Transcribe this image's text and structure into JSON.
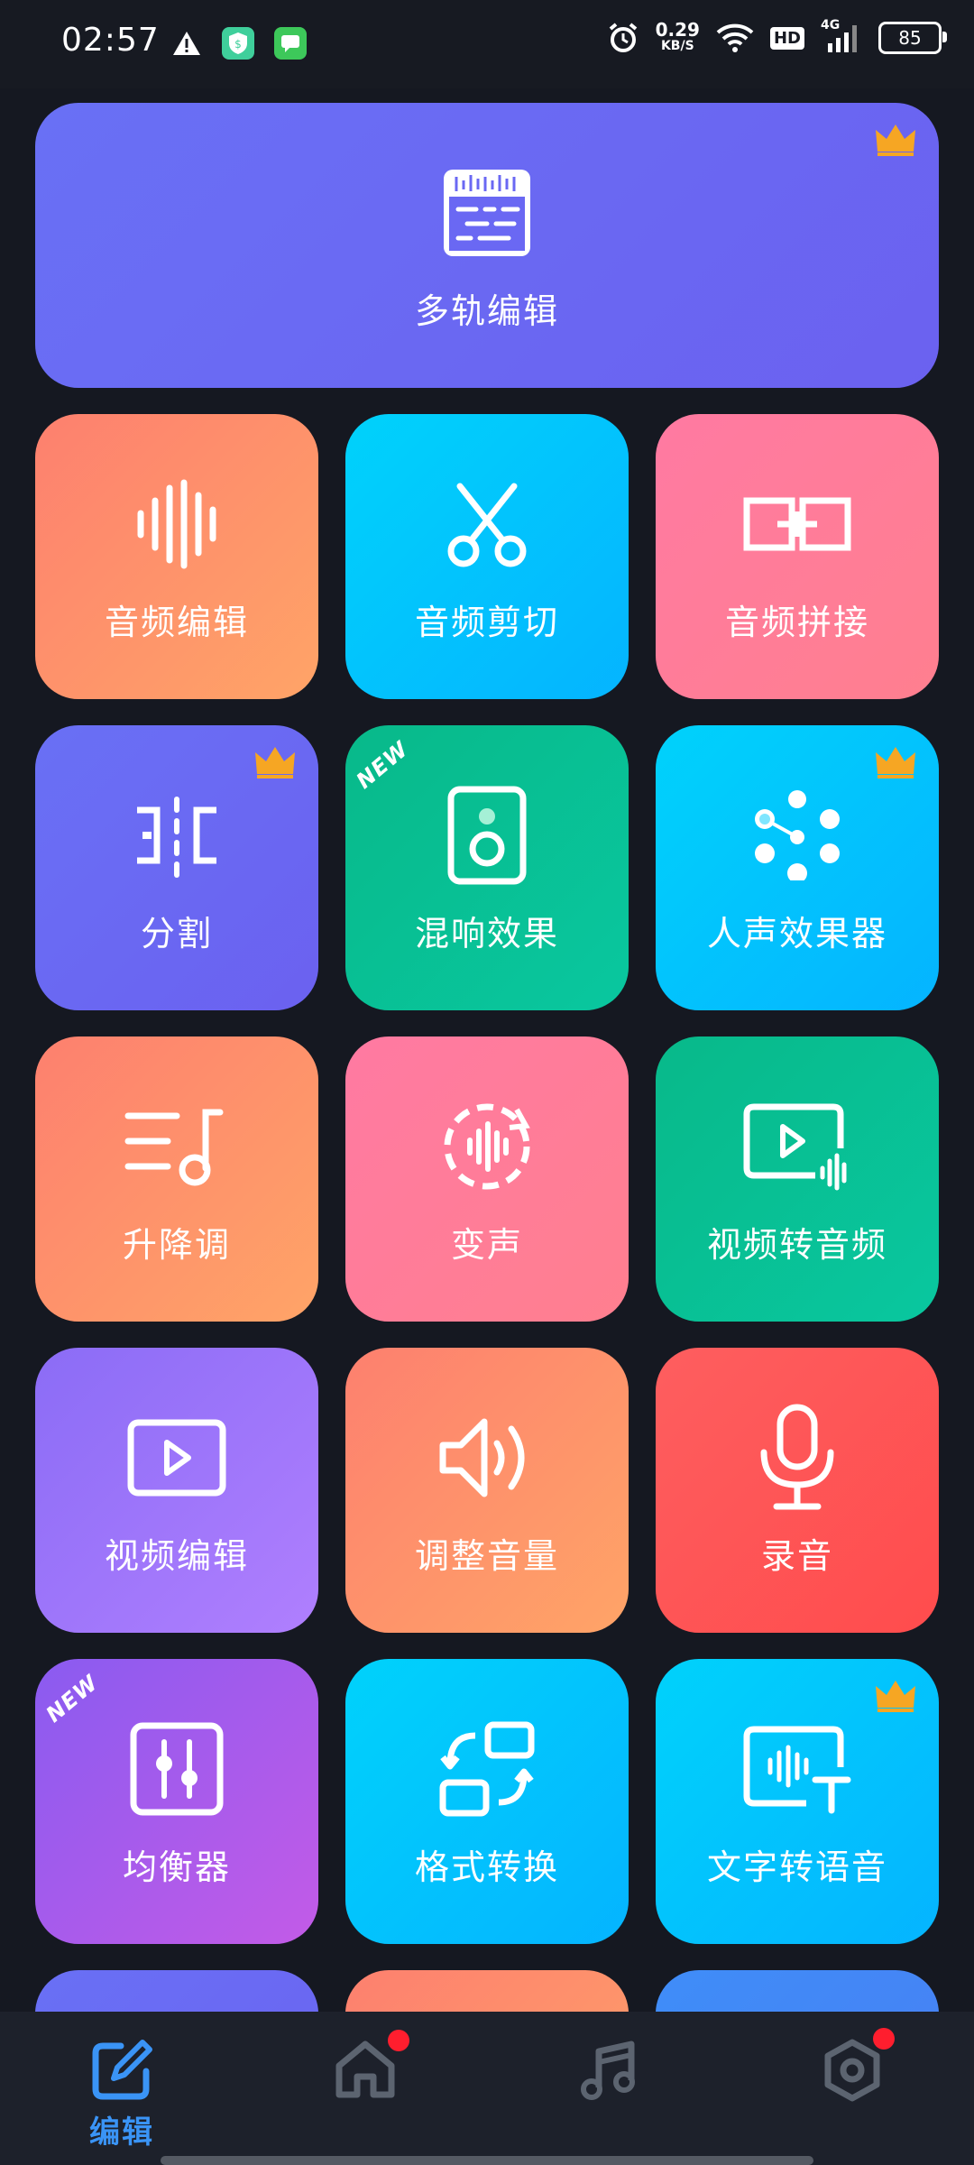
{
  "status_bar": {
    "time": "02:57",
    "speed_value": "0.29",
    "speed_unit": "KB/S",
    "network": "4G",
    "hd": "HD",
    "battery": "85",
    "icons": [
      "warning-icon",
      "shield-app-icon",
      "message-app-icon",
      "alarm-icon",
      "wifi-icon",
      "signal-icon",
      "battery-icon"
    ]
  },
  "colors": {
    "background": "#151821",
    "nav_active": "#3a94f6",
    "badge": "#ff1e2e",
    "crown": "#f6a623"
  },
  "tools": [
    {
      "id": "multitrack",
      "label": "多轨编辑",
      "icon": "multitrack-icon",
      "premium": true,
      "new": false
    },
    {
      "id": "audio-edit",
      "label": "音频编辑",
      "icon": "waveform-icon",
      "premium": false,
      "new": false
    },
    {
      "id": "audio-cut",
      "label": "音频剪切",
      "icon": "scissors-icon",
      "premium": false,
      "new": false
    },
    {
      "id": "audio-join",
      "label": "音频拼接",
      "icon": "join-icon",
      "premium": false,
      "new": false
    },
    {
      "id": "split",
      "label": "分割",
      "icon": "split-icon",
      "premium": true,
      "new": false
    },
    {
      "id": "reverb",
      "label": "混响效果",
      "icon": "speaker-icon",
      "premium": false,
      "new": true
    },
    {
      "id": "vocal-fx",
      "label": "人声效果器",
      "icon": "dots-icon",
      "premium": true,
      "new": false
    },
    {
      "id": "pitch",
      "label": "升降调",
      "icon": "pitch-icon",
      "premium": false,
      "new": false
    },
    {
      "id": "voice-change",
      "label": "变声",
      "icon": "voice-change-icon",
      "premium": false,
      "new": false
    },
    {
      "id": "video-to-audio",
      "label": "视频转音频",
      "icon": "video-audio-icon",
      "premium": false,
      "new": false
    },
    {
      "id": "video-edit",
      "label": "视频编辑",
      "icon": "video-icon",
      "premium": false,
      "new": false
    },
    {
      "id": "volume",
      "label": "调整音量",
      "icon": "volume-icon",
      "premium": false,
      "new": false
    },
    {
      "id": "record",
      "label": "录音",
      "icon": "microphone-icon",
      "premium": false,
      "new": false
    },
    {
      "id": "equalizer",
      "label": "均衡器",
      "icon": "equalizer-icon",
      "premium": false,
      "new": true
    },
    {
      "id": "format",
      "label": "格式转换",
      "icon": "convert-icon",
      "premium": false,
      "new": false
    },
    {
      "id": "tts",
      "label": "文字转语音",
      "icon": "text-to-speech-icon",
      "premium": true,
      "new": false
    }
  ],
  "new_tag": "NEW",
  "bottom_nav": [
    {
      "id": "edit",
      "label": "编辑",
      "icon": "edit-icon",
      "active": true,
      "badge": false
    },
    {
      "id": "home",
      "label": "",
      "icon": "home-icon",
      "active": false,
      "badge": true
    },
    {
      "id": "music",
      "label": "",
      "icon": "music-icon",
      "active": false,
      "badge": false
    },
    {
      "id": "settings",
      "label": "",
      "icon": "settings-icon",
      "active": false,
      "badge": true
    }
  ]
}
